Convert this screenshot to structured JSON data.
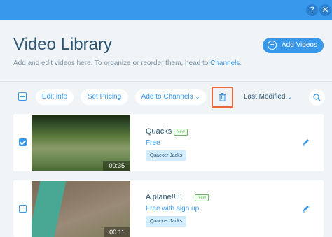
{
  "topbar": {
    "help_label": "?",
    "close_label": "✕",
    "color": "#3899ec"
  },
  "header": {
    "title": "Video Library",
    "subtitle_prefix": "Add and edit videos here. To organize or reorder them, head to ",
    "subtitle_link": "Channels",
    "subtitle_suffix": ".",
    "add_button_label": "Add Videos"
  },
  "toolbar": {
    "edit_info_label": "Edit info",
    "set_pricing_label": "Set Pricing",
    "add_to_channels_label": "Add to Channels",
    "sort_label": "Last Modified",
    "delete_icon": "trash-icon",
    "search_icon": "search-icon"
  },
  "videos": [
    {
      "name": "Quacks",
      "badge": "New",
      "pricing": "Free",
      "channel": "Quacker Jacks",
      "duration": "00:35",
      "checked": true
    },
    {
      "name": "A plane!!!!!",
      "badge": "New",
      "pricing": "Free with sign up",
      "channel": "Quacker Jacks",
      "duration": "00:11",
      "checked": false
    }
  ],
  "colors": {
    "accent": "#3899ec",
    "highlight_border": "#e8683d",
    "new_badge": "#60bc57",
    "title": "#2b5672"
  }
}
